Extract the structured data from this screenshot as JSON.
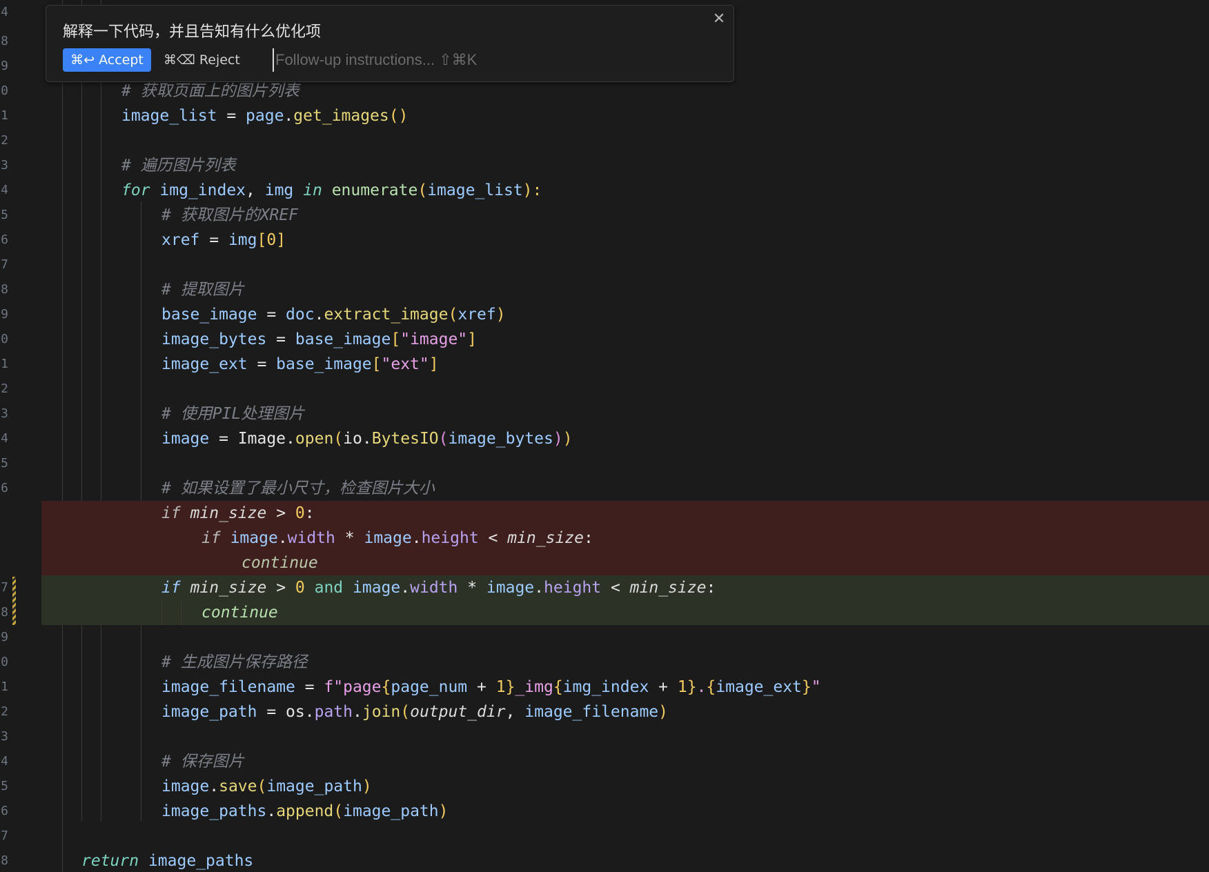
{
  "gutter": {
    "line_numbers": [
      "4",
      "8",
      "9",
      "0",
      "1",
      "2",
      "3",
      "4",
      "5",
      "6",
      "7",
      "8",
      "9",
      "0",
      "1",
      "2",
      "3",
      "4",
      "5",
      "6",
      "7",
      "8",
      "9",
      "0",
      "1",
      "2",
      "3",
      "4",
      "5",
      "6",
      "7",
      "8"
    ]
  },
  "inline_prompt": {
    "title": "解释一下代码，并且告知有什么优化项",
    "accept_label": "⌘↩ Accept",
    "reject_label": "⌘⌫ Reject",
    "followup_placeholder": "Follow-up instructions... ⇧⌘K",
    "close_glyph": "✕"
  },
  "code": {
    "c1": "# 获取页面上的图片列表",
    "l1": [
      "image_list",
      " = ",
      "page",
      ".",
      "get_images",
      "()"
    ],
    "c2": "# 遍历图片列表",
    "l2": [
      "for",
      " ",
      "img_index",
      ", ",
      "img",
      " ",
      "in",
      " ",
      "enumerate",
      "(",
      "image_list",
      "):"
    ],
    "c3": "# 获取图片的XREF",
    "l3": [
      "xref",
      " = ",
      "img",
      "[",
      "0",
      "]"
    ],
    "c4": "# 提取图片",
    "l4": [
      "base_image",
      " = ",
      "doc",
      ".",
      "extract_image",
      "(",
      "xref",
      ")"
    ],
    "l5": [
      "image_bytes",
      " = ",
      "base_image",
      "[",
      "\"image\"",
      "]"
    ],
    "l6": [
      "image_ext",
      " = ",
      "base_image",
      "[",
      "\"ext\"",
      "]"
    ],
    "c5": "# 使用PIL处理图片",
    "l7": [
      "image",
      " = ",
      "Image",
      ".",
      "open",
      "(",
      "io",
      ".",
      "BytesIO",
      "(",
      "image_bytes",
      ")",
      ")"
    ],
    "c6": "# 如果设置了最小尺寸，检查图片大小",
    "d1": [
      "if",
      " ",
      "min_size",
      " > ",
      "0",
      ":"
    ],
    "d2": [
      "if",
      " ",
      "image",
      ".",
      "width",
      " * ",
      "image",
      ".",
      "height",
      " < ",
      "min_size",
      ":"
    ],
    "d3": [
      "continue"
    ],
    "a1": [
      "if",
      " ",
      "min_size",
      " > ",
      "0",
      " ",
      "and",
      " ",
      "image",
      ".",
      "width",
      " * ",
      "image",
      ".",
      "height",
      " < ",
      "min_size",
      ":"
    ],
    "a2": [
      "continue"
    ],
    "c7": "# 生成图片保存路径",
    "l8": [
      "image_filename",
      " = ",
      "f\"page",
      "{",
      "page_num",
      " + ",
      "1",
      "}",
      "_img",
      "{",
      "img_index",
      " + ",
      "1",
      "}",
      ".",
      "{",
      "image_ext",
      "}",
      "\""
    ],
    "l9": [
      "image_path",
      " = ",
      "os",
      ".",
      "path",
      ".",
      "join",
      "(",
      "output_dir",
      ", ",
      "image_filename",
      ")"
    ],
    "c8": "# 保存图片",
    "l10": [
      "image",
      ".",
      "save",
      "(",
      "image_path",
      ")"
    ],
    "l11": [
      "image_paths",
      ".",
      "append",
      "(",
      "image_path",
      ")"
    ],
    "l12": [
      "return",
      " ",
      "image_paths"
    ]
  },
  "colors": {
    "background": "#1b1b1b",
    "deleted_bg": "#3e1f1e",
    "added_bg": "#2c3226",
    "accent": "#3b82f6"
  }
}
